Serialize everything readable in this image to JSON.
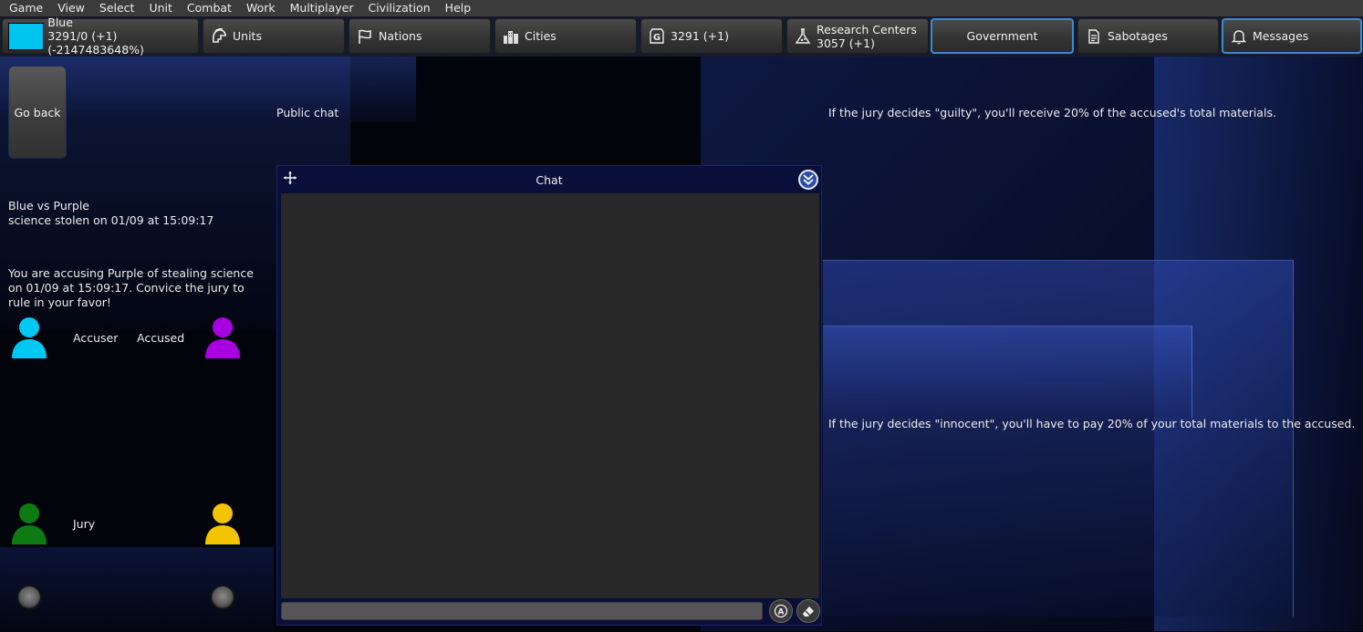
{
  "menu": [
    "Game",
    "View",
    "Select",
    "Unit",
    "Combat",
    "Work",
    "Multiplayer",
    "Civilization",
    "Help"
  ],
  "toolbar": {
    "player_name": "Blue",
    "player_stats": "3291/0 (+1) (-2147483648%)",
    "player_color": "#00c4f0",
    "units_label": "Units",
    "nations_label": "Nations",
    "cities_label": "Cities",
    "gold_label": "3291 (+1)",
    "research_label": "Research Centers",
    "research_value": "3057 (+1)",
    "government_label": "Government",
    "sabotages_label": "Sabotages",
    "messages_label": "Messages"
  },
  "left": {
    "go_back": "Go back",
    "public_chat": "Public chat",
    "case_title": "Blue vs Purple",
    "case_subtitle": "science stolen on 01/09 at 15:09:17",
    "accusation": "You are accusing Purple of stealing science on 01/09 at 15:09:17. Convice the jury to rule in your favor!",
    "accuser_label": "Accuser",
    "accused_label": "Accused",
    "jury_label": "Jury",
    "accuser_color": "#00c8f4",
    "accused_color": "#a800e0",
    "jury_left_color": "#0d7a14",
    "jury_right_color": "#f5c400"
  },
  "chat": {
    "title": "Chat",
    "input_value": ""
  },
  "right": {
    "guilty_text": "If the jury decides \"guilty\", you'll receive 20% of the accused's total materials.",
    "innocent_text": "If the jury decides \"innocent\", you'll have to pay 20% of your total materials to the accused."
  }
}
